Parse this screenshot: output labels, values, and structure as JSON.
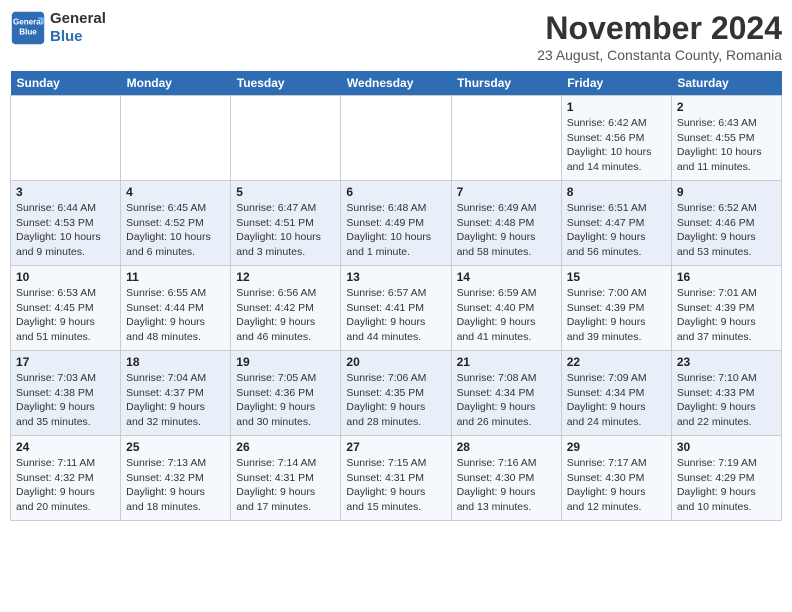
{
  "logo": {
    "line1": "General",
    "line2": "Blue"
  },
  "title": "November 2024",
  "subtitle": "23 August, Constanta County, Romania",
  "days_of_week": [
    "Sunday",
    "Monday",
    "Tuesday",
    "Wednesday",
    "Thursday",
    "Friday",
    "Saturday"
  ],
  "weeks": [
    [
      {
        "day": "",
        "detail": ""
      },
      {
        "day": "",
        "detail": ""
      },
      {
        "day": "",
        "detail": ""
      },
      {
        "day": "",
        "detail": ""
      },
      {
        "day": "",
        "detail": ""
      },
      {
        "day": "1",
        "detail": "Sunrise: 6:42 AM\nSunset: 4:56 PM\nDaylight: 10 hours and 14 minutes."
      },
      {
        "day": "2",
        "detail": "Sunrise: 6:43 AM\nSunset: 4:55 PM\nDaylight: 10 hours and 11 minutes."
      }
    ],
    [
      {
        "day": "3",
        "detail": "Sunrise: 6:44 AM\nSunset: 4:53 PM\nDaylight: 10 hours and 9 minutes."
      },
      {
        "day": "4",
        "detail": "Sunrise: 6:45 AM\nSunset: 4:52 PM\nDaylight: 10 hours and 6 minutes."
      },
      {
        "day": "5",
        "detail": "Sunrise: 6:47 AM\nSunset: 4:51 PM\nDaylight: 10 hours and 3 minutes."
      },
      {
        "day": "6",
        "detail": "Sunrise: 6:48 AM\nSunset: 4:49 PM\nDaylight: 10 hours and 1 minute."
      },
      {
        "day": "7",
        "detail": "Sunrise: 6:49 AM\nSunset: 4:48 PM\nDaylight: 9 hours and 58 minutes."
      },
      {
        "day": "8",
        "detail": "Sunrise: 6:51 AM\nSunset: 4:47 PM\nDaylight: 9 hours and 56 minutes."
      },
      {
        "day": "9",
        "detail": "Sunrise: 6:52 AM\nSunset: 4:46 PM\nDaylight: 9 hours and 53 minutes."
      }
    ],
    [
      {
        "day": "10",
        "detail": "Sunrise: 6:53 AM\nSunset: 4:45 PM\nDaylight: 9 hours and 51 minutes."
      },
      {
        "day": "11",
        "detail": "Sunrise: 6:55 AM\nSunset: 4:44 PM\nDaylight: 9 hours and 48 minutes."
      },
      {
        "day": "12",
        "detail": "Sunrise: 6:56 AM\nSunset: 4:42 PM\nDaylight: 9 hours and 46 minutes."
      },
      {
        "day": "13",
        "detail": "Sunrise: 6:57 AM\nSunset: 4:41 PM\nDaylight: 9 hours and 44 minutes."
      },
      {
        "day": "14",
        "detail": "Sunrise: 6:59 AM\nSunset: 4:40 PM\nDaylight: 9 hours and 41 minutes."
      },
      {
        "day": "15",
        "detail": "Sunrise: 7:00 AM\nSunset: 4:39 PM\nDaylight: 9 hours and 39 minutes."
      },
      {
        "day": "16",
        "detail": "Sunrise: 7:01 AM\nSunset: 4:39 PM\nDaylight: 9 hours and 37 minutes."
      }
    ],
    [
      {
        "day": "17",
        "detail": "Sunrise: 7:03 AM\nSunset: 4:38 PM\nDaylight: 9 hours and 35 minutes."
      },
      {
        "day": "18",
        "detail": "Sunrise: 7:04 AM\nSunset: 4:37 PM\nDaylight: 9 hours and 32 minutes."
      },
      {
        "day": "19",
        "detail": "Sunrise: 7:05 AM\nSunset: 4:36 PM\nDaylight: 9 hours and 30 minutes."
      },
      {
        "day": "20",
        "detail": "Sunrise: 7:06 AM\nSunset: 4:35 PM\nDaylight: 9 hours and 28 minutes."
      },
      {
        "day": "21",
        "detail": "Sunrise: 7:08 AM\nSunset: 4:34 PM\nDaylight: 9 hours and 26 minutes."
      },
      {
        "day": "22",
        "detail": "Sunrise: 7:09 AM\nSunset: 4:34 PM\nDaylight: 9 hours and 24 minutes."
      },
      {
        "day": "23",
        "detail": "Sunrise: 7:10 AM\nSunset: 4:33 PM\nDaylight: 9 hours and 22 minutes."
      }
    ],
    [
      {
        "day": "24",
        "detail": "Sunrise: 7:11 AM\nSunset: 4:32 PM\nDaylight: 9 hours and 20 minutes."
      },
      {
        "day": "25",
        "detail": "Sunrise: 7:13 AM\nSunset: 4:32 PM\nDaylight: 9 hours and 18 minutes."
      },
      {
        "day": "26",
        "detail": "Sunrise: 7:14 AM\nSunset: 4:31 PM\nDaylight: 9 hours and 17 minutes."
      },
      {
        "day": "27",
        "detail": "Sunrise: 7:15 AM\nSunset: 4:31 PM\nDaylight: 9 hours and 15 minutes."
      },
      {
        "day": "28",
        "detail": "Sunrise: 7:16 AM\nSunset: 4:30 PM\nDaylight: 9 hours and 13 minutes."
      },
      {
        "day": "29",
        "detail": "Sunrise: 7:17 AM\nSunset: 4:30 PM\nDaylight: 9 hours and 12 minutes."
      },
      {
        "day": "30",
        "detail": "Sunrise: 7:19 AM\nSunset: 4:29 PM\nDaylight: 9 hours and 10 minutes."
      }
    ]
  ]
}
